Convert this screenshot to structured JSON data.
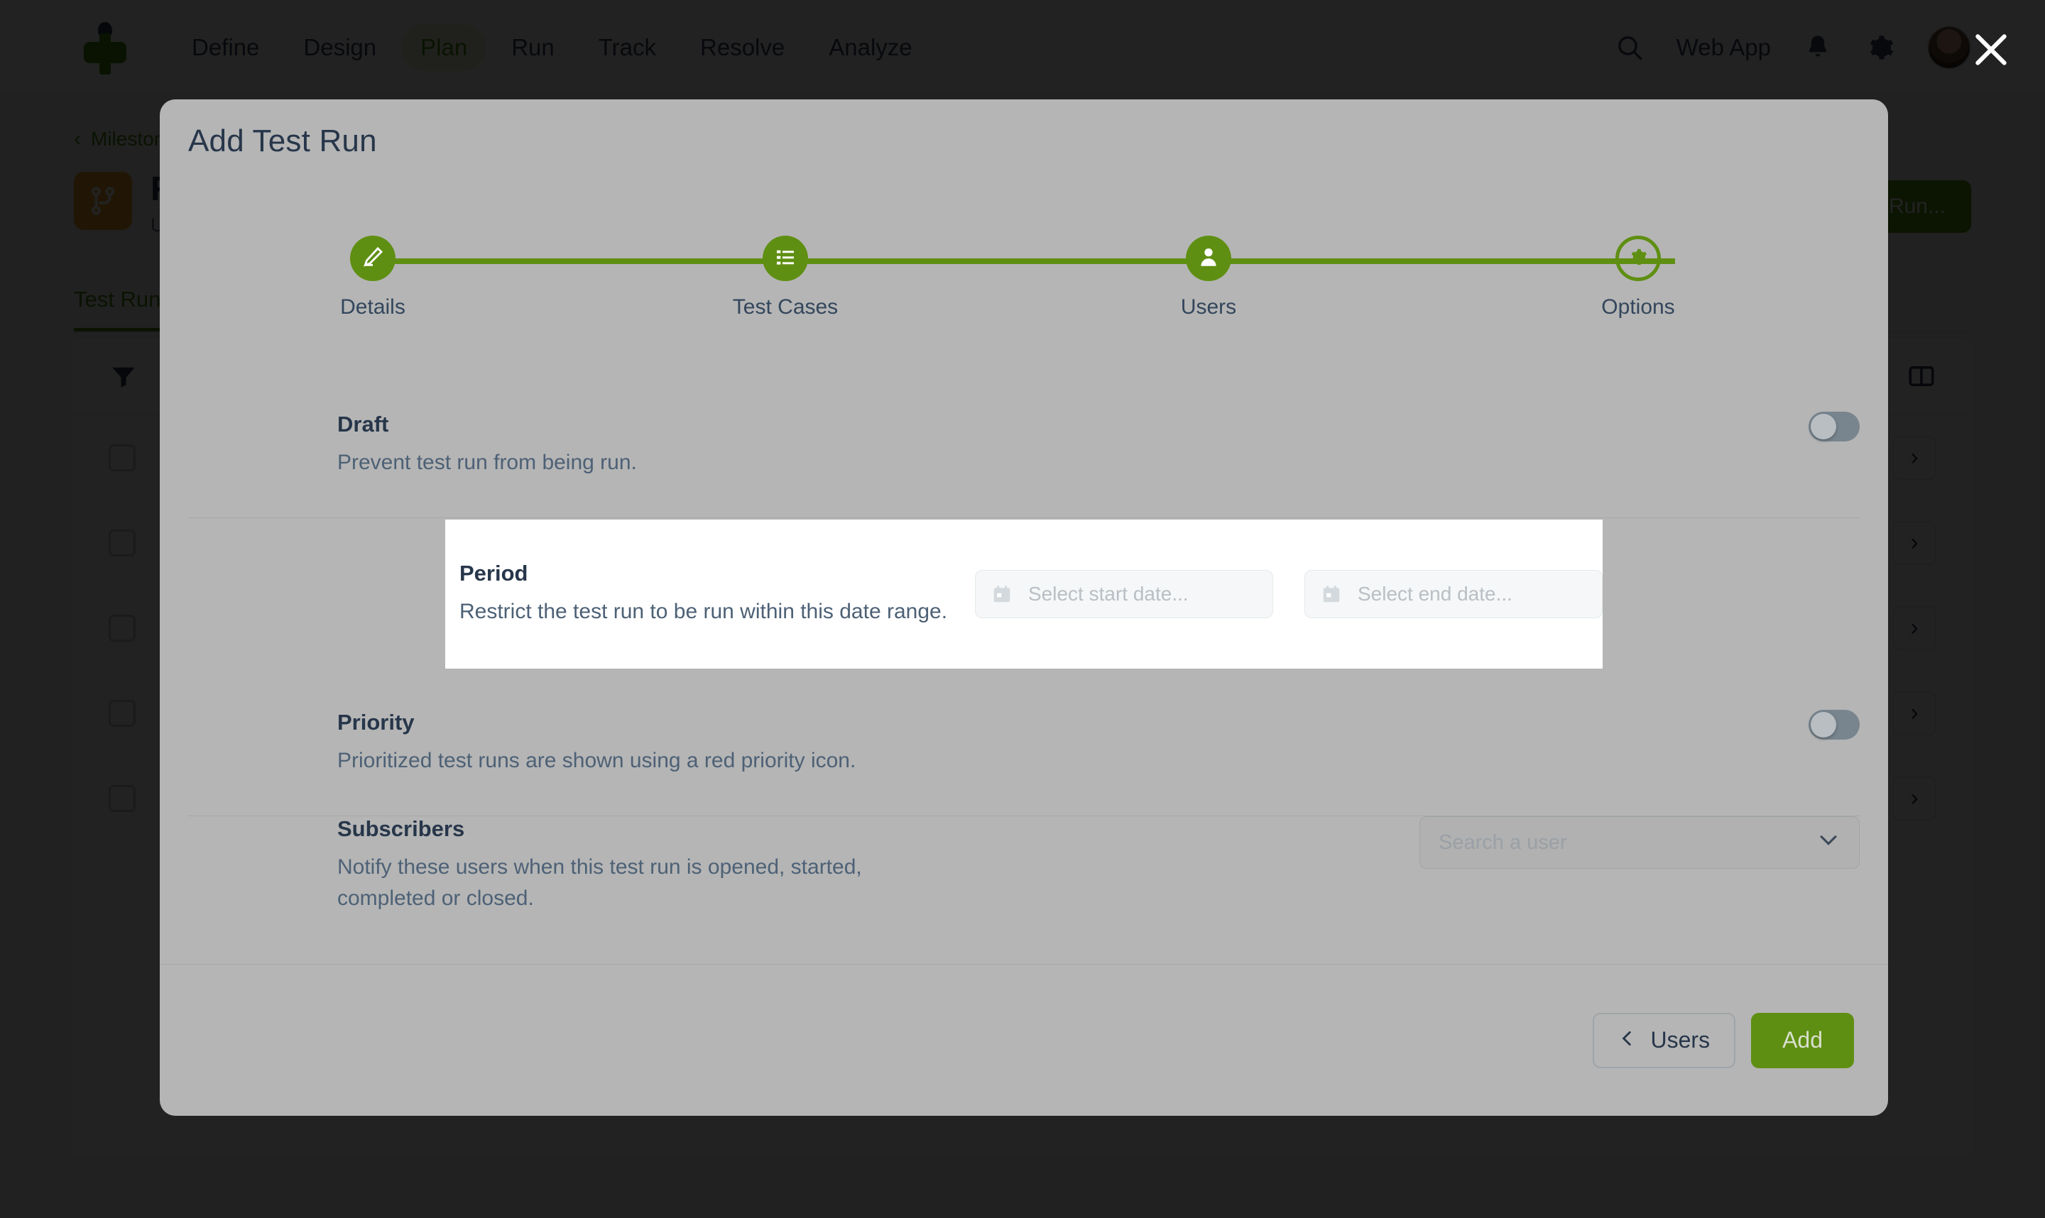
{
  "topbar": {
    "logo_name": "testmo-logo",
    "nav_items": [
      {
        "label": "Define",
        "active": false
      },
      {
        "label": "Design",
        "active": false
      },
      {
        "label": "Plan",
        "active": true
      },
      {
        "label": "Run",
        "active": false
      },
      {
        "label": "Track",
        "active": false
      },
      {
        "label": "Resolve",
        "active": false
      },
      {
        "label": "Analyze",
        "active": false
      }
    ],
    "search_icon": "search-icon",
    "webapp_label": "Web App",
    "bell_icon": "bell-icon",
    "gear_icon": "gear-icon",
    "avatar_alt": "user-avatar",
    "close_icon": "close-icon"
  },
  "background": {
    "breadcrumb_chevron": "chevron-left-icon",
    "breadcrumb_label": "Milestones",
    "project_icon": "branch-icon",
    "project_title": "Release",
    "project_subtitle": "Upcoming",
    "add_run_button": "Add Test Run...",
    "tab_label": "Test Runs",
    "filter_icon": "filter-icon",
    "columns_icon": "columns-icon",
    "row_checkbox": "checkbox-unchecked",
    "row_chevron": "chevron-right-icon",
    "row_count": 5
  },
  "modal": {
    "title": "Add Test Run",
    "steps": [
      {
        "label": "Details",
        "icon": "edit-icon",
        "state": "complete"
      },
      {
        "label": "Test Cases",
        "icon": "list-icon",
        "state": "complete"
      },
      {
        "label": "Users",
        "icon": "person-icon",
        "state": "complete"
      },
      {
        "label": "Options",
        "icon": "gear-icon",
        "state": "current"
      }
    ],
    "options": [
      {
        "key": "draft",
        "title": "Draft",
        "description": "Prevent test run from being run.",
        "control": "toggle",
        "toggle_on": false
      },
      {
        "key": "period",
        "title": "Period",
        "description": "Restrict the test run to be run within this date range.",
        "control": "date-range",
        "highlighted": true,
        "start_placeholder": "Select start date...",
        "start_value": "",
        "end_placeholder": "Select end date...",
        "end_value": "",
        "calendar_icon": "calendar-icon"
      },
      {
        "key": "priority",
        "title": "Priority",
        "description": "Prioritized test runs are shown using a red priority icon.",
        "control": "toggle",
        "toggle_on": false
      },
      {
        "key": "subscribers",
        "title": "Subscribers",
        "description": "Notify these users when this test run is opened, started, completed or closed.",
        "control": "select",
        "select_placeholder": "Search a user",
        "select_value": "",
        "chevron_icon": "chevron-down-icon"
      }
    ],
    "footer": {
      "back_label": "Users",
      "back_icon": "chevron-left-icon",
      "submit_label": "Add"
    }
  },
  "colors": {
    "brand_green": "#5f8f12",
    "text_dark": "#27364a",
    "text_muted": "#4d6176",
    "modal_bg": "#b5b5b5",
    "highlight_bg": "#ffffff",
    "toggle_track": "#78858e"
  }
}
